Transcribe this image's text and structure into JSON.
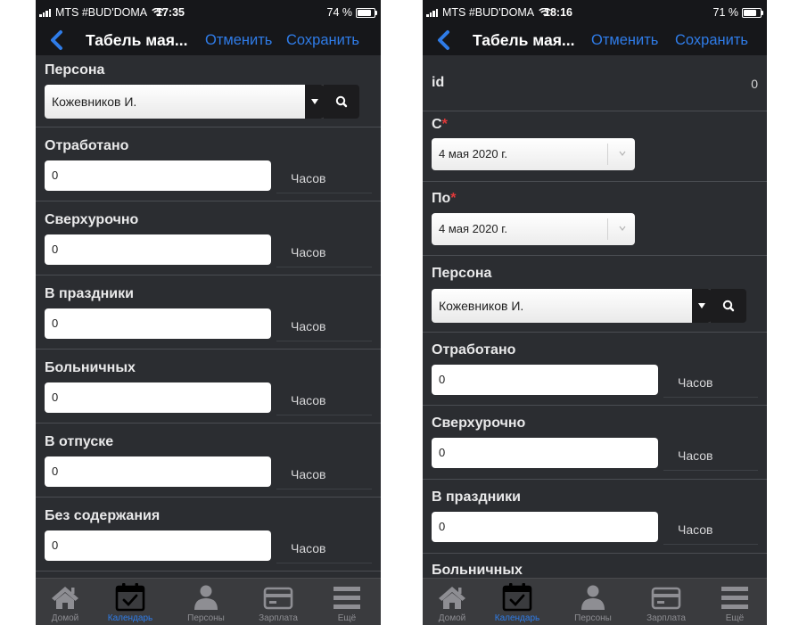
{
  "left": {
    "status": {
      "carrier": "MTS #BUD'DOMA",
      "time": "17:35",
      "battery": "74 %",
      "battery_level": 0.74
    },
    "nav": {
      "title": "Табель мая...",
      "cancel": "Отменить",
      "save": "Сохранить"
    },
    "person": {
      "label": "Персона",
      "value": "Кожевников И."
    },
    "fields": [
      {
        "label": "Отработано",
        "value": "0",
        "unit": "Часов"
      },
      {
        "label": "Сверхурочно",
        "value": "0",
        "unit": "Часов"
      },
      {
        "label": "В праздники",
        "value": "0",
        "unit": "Часов"
      },
      {
        "label": "Больничных",
        "value": "0",
        "unit": "Часов"
      },
      {
        "label": "В отпуске",
        "value": "0",
        "unit": "Часов"
      },
      {
        "label": "Без содержания",
        "value": "0",
        "unit": "Часов"
      }
    ],
    "tabs": [
      {
        "label": "Домой",
        "icon": "home-icon"
      },
      {
        "label": "Календарь",
        "icon": "calendar-icon"
      },
      {
        "label": "Персоны",
        "icon": "person-icon"
      },
      {
        "label": "Зарплата",
        "icon": "credit-card-icon"
      },
      {
        "label": "Ещё",
        "icon": "menu-icon"
      }
    ]
  },
  "right": {
    "status": {
      "carrier": "MTS #BUD'DOMA",
      "time": "18:16",
      "battery": "71 %",
      "battery_level": 0.71
    },
    "nav": {
      "title": "Табель мая...",
      "cancel": "Отменить",
      "save": "Сохранить"
    },
    "id": {
      "label": "id",
      "value": "0"
    },
    "from": {
      "label": "С",
      "required": "*",
      "value": "4 мая 2020 г."
    },
    "to": {
      "label": "По",
      "required": "*",
      "value": "4 мая 2020 г."
    },
    "person": {
      "label": "Персона",
      "value": "Кожевников И."
    },
    "fields": [
      {
        "label": "Отработано",
        "value": "0",
        "unit": "Часов"
      },
      {
        "label": "Сверхурочно",
        "value": "0",
        "unit": "Часов"
      },
      {
        "label": "В праздники",
        "value": "0",
        "unit": "Часов"
      },
      {
        "label": "Больничных"
      }
    ],
    "tabs": [
      {
        "label": "Домой",
        "icon": "home-icon"
      },
      {
        "label": "Календарь",
        "icon": "calendar-icon"
      },
      {
        "label": "Персоны",
        "icon": "person-icon"
      },
      {
        "label": "Зарплата",
        "icon": "credit-card-icon"
      },
      {
        "label": "Ещё",
        "icon": "menu-icon"
      }
    ]
  },
  "colors": {
    "accent": "#2f7ce8",
    "background": "#2b2d31",
    "bar": "#16171a",
    "tabbar": "#3a3b3e",
    "required": "#e0393a"
  }
}
